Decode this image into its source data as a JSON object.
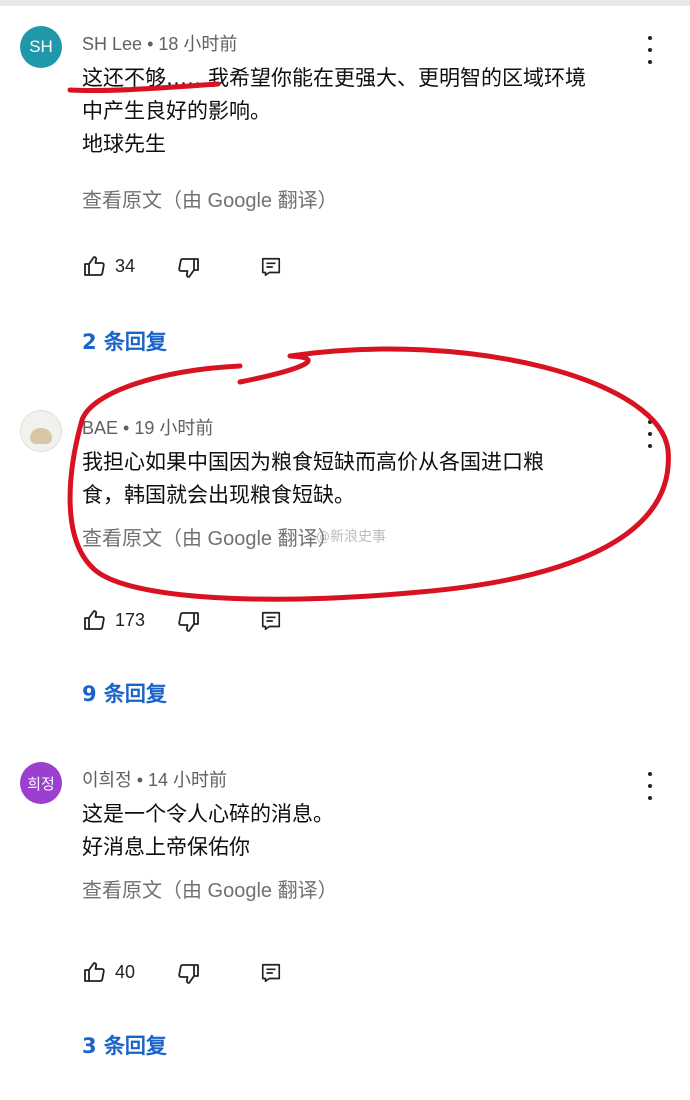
{
  "comments": [
    {
      "author": "SH Lee",
      "avatar_text": "SH",
      "avatar_color": "#1f98a9",
      "time": "18 小时前",
      "lines": [
        "这还不够……我希望你能在更强大、更明智的区域环境",
        "中产生良好的影响。",
        "地球先生"
      ],
      "translate": "查看原文（由 Google 翻译）",
      "likes": "34",
      "replies": "2 条回复"
    },
    {
      "author": "BAE",
      "avatar_text": "",
      "avatar_color": "#f2f1ee",
      "time": "19 小时前",
      "lines": [
        "我担心如果中国因为粮食短缺而高价从各国进口粮",
        "食，韩国就会出现粮食短缺。"
      ],
      "translate": "查看原文（由 Google 翻译）",
      "likes": "173",
      "replies": "9 条回复"
    },
    {
      "author": "이희정",
      "avatar_text": "희정",
      "avatar_color": "#9b3fd1",
      "time": "14 小时前",
      "lines": [
        "这是一个令人心碎的消息。",
        "好消息上帝保佑你"
      ],
      "translate": "查看原文（由 Google 翻译）",
      "likes": "40",
      "replies": "3 条回复"
    }
  ],
  "watermark": "@新浪史事",
  "annotation_color": "#d81221"
}
